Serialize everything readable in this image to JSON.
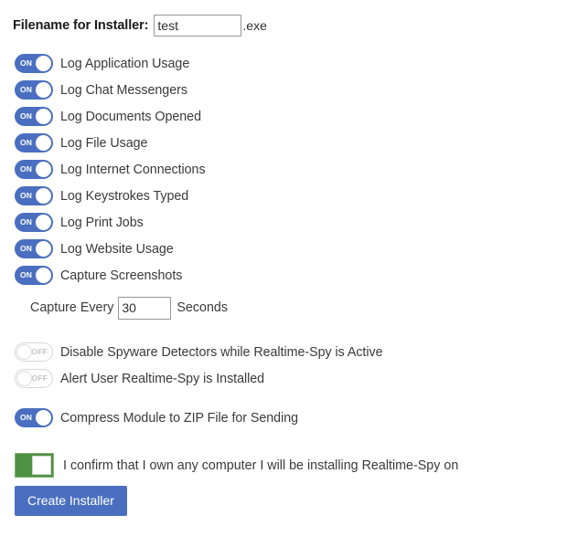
{
  "filename": {
    "label": "Filename for Installer:",
    "value": "test",
    "placeholder": "",
    "extension": ".exe"
  },
  "logging_toggles": [
    {
      "label": "Log Application Usage",
      "state": "ON",
      "on_text": "ON"
    },
    {
      "label": "Log Chat Messengers",
      "state": "ON",
      "on_text": "ON"
    },
    {
      "label": "Log Documents Opened",
      "state": "ON",
      "on_text": "ON"
    },
    {
      "label": "Log File Usage",
      "state": "ON",
      "on_text": "ON"
    },
    {
      "label": "Log Internet Connections",
      "state": "ON",
      "on_text": "ON"
    },
    {
      "label": "Log Keystrokes Typed",
      "state": "ON",
      "on_text": "ON"
    },
    {
      "label": "Log Print Jobs",
      "state": "ON",
      "on_text": "ON"
    },
    {
      "label": "Log Website Usage",
      "state": "ON",
      "on_text": "ON"
    },
    {
      "label": "Capture Screenshots",
      "state": "ON",
      "on_text": "ON"
    }
  ],
  "capture_interval": {
    "prefix": "Capture Every",
    "value": "30",
    "placeholder": "",
    "suffix": "Seconds"
  },
  "stealth_toggles": [
    {
      "label": "Disable Spyware Detectors while Realtime-Spy is Active",
      "state": "OFF",
      "off_text": "OFF"
    },
    {
      "label": "Alert User Realtime-Spy is Installed",
      "state": "OFF",
      "off_text": "OFF"
    }
  ],
  "compress_toggle": {
    "label": "Compress Module to ZIP File for Sending",
    "state": "ON",
    "on_text": "ON"
  },
  "confirm": {
    "label": "I confirm that I own any computer I will be installing Realtime-Spy on",
    "state": "ON"
  },
  "actions": {
    "create_installer_label": "Create Installer"
  },
  "colors": {
    "toggle_on": "#4a6fc0",
    "toggle_off_border": "#d7d7d7",
    "confirm_green": "#4f9144",
    "button_blue": "#4a6fc0",
    "text": "#3a3a3a"
  }
}
